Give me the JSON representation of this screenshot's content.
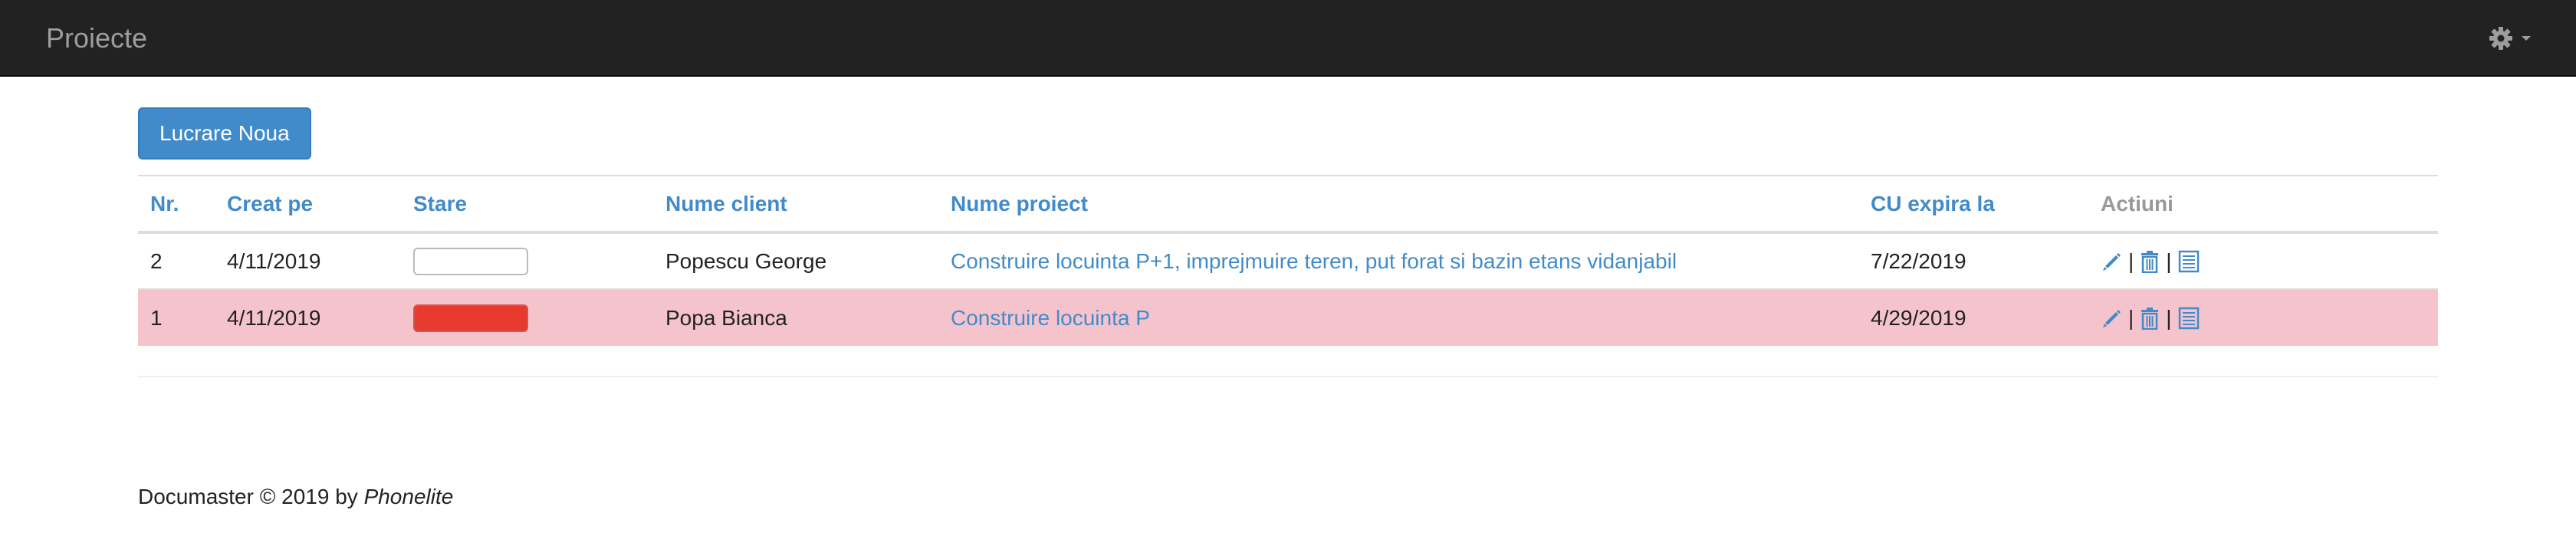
{
  "navbar": {
    "brand": "Proiecte",
    "settings_icon": "gear-icon",
    "dropdown_icon": "caret-down-icon"
  },
  "toolbar": {
    "new_label": "Lucrare Noua"
  },
  "table": {
    "columns": [
      "Nr.",
      "Creat pe",
      "Stare",
      "Nume client",
      "Nume proiect",
      "CU expira la",
      "Actiuni"
    ],
    "rows": [
      {
        "nr": "2",
        "created": "4/11/2019",
        "status": "empty",
        "client": "Popescu George",
        "project": "Construire locuinta P+1, imprejmuire teren, put forat si bazin etans vidanjabil",
        "expires": "7/22/2019",
        "highlight": false
      },
      {
        "nr": "1",
        "created": "4/11/2019",
        "status": "red",
        "client": "Popa Bianca",
        "project": "Construire locuinta P",
        "expires": "4/29/2019",
        "highlight": true
      }
    ],
    "action_icons": [
      "pencil-icon",
      "trash-icon",
      "list-icon"
    ],
    "action_separator": "|"
  },
  "footer": {
    "text": "Documaster © 2019 by",
    "author": "Phonelite"
  },
  "colors": {
    "navbar_bg": "#222222",
    "accent": "#428bca",
    "danger_row": "#f5c3cc",
    "status_red": "#e8392f"
  }
}
